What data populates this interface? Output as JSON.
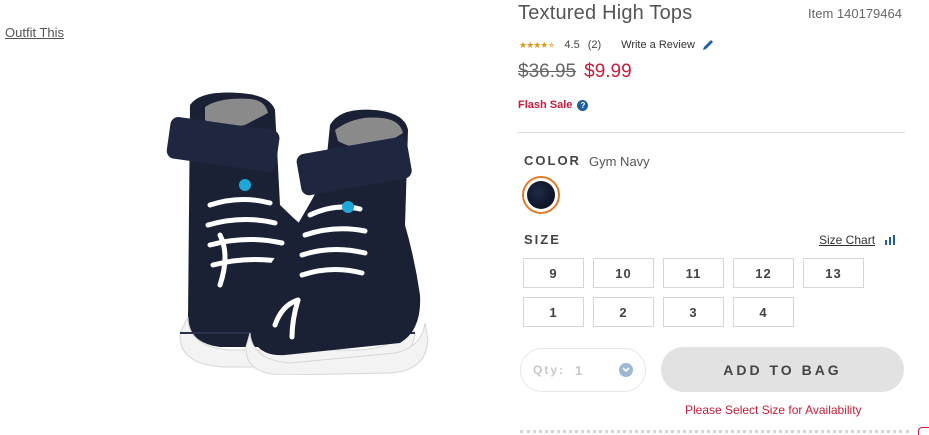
{
  "outfit_link": "Outfit This",
  "product": {
    "title": "Textured High Tops",
    "item_number": "Item 140179464",
    "rating": {
      "value": "4.5",
      "count": "(2)",
      "stars": 4.5,
      "write_review": "Write a Review"
    },
    "price": {
      "original": "$36.95",
      "sale": "$9.99"
    },
    "flash_sale": "Flash Sale",
    "help_glyph": "?"
  },
  "color": {
    "label": "COLOR",
    "selected": "Gym Navy",
    "swatch_color": "#0e1426",
    "swatch_ring": "#e07b2a"
  },
  "size": {
    "label": "SIZE",
    "chart_link": "Size Chart",
    "options": [
      "9",
      "10",
      "11",
      "12",
      "13",
      "1",
      "2",
      "3",
      "4"
    ]
  },
  "quantity": {
    "label": "Qty:",
    "value": "1"
  },
  "add_to_bag": "ADD TO BAG",
  "availability_message": "Please Select Size for Availability",
  "colors": {
    "sale_red": "#c41d3a",
    "link_blue": "#1d5fa0",
    "star_gold": "#d99a1e"
  }
}
